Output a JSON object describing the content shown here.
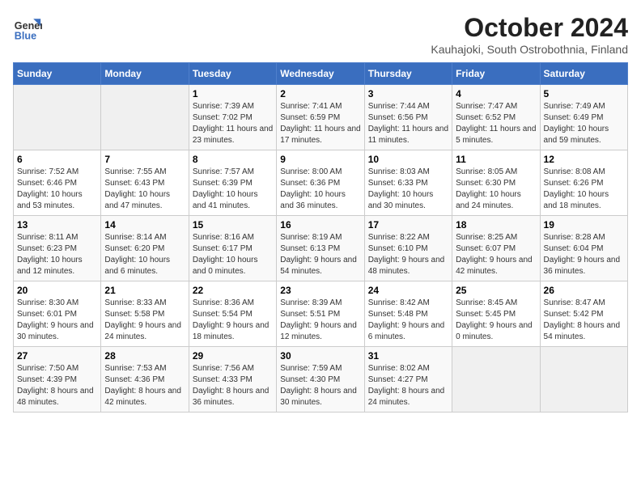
{
  "header": {
    "logo_line1": "General",
    "logo_line2": "Blue",
    "title": "October 2024",
    "subtitle": "Kauhajoki, South Ostrobothnia, Finland"
  },
  "weekdays": [
    "Sunday",
    "Monday",
    "Tuesday",
    "Wednesday",
    "Thursday",
    "Friday",
    "Saturday"
  ],
  "weeks": [
    [
      {
        "day": "",
        "info": ""
      },
      {
        "day": "",
        "info": ""
      },
      {
        "day": "1",
        "info": "Sunrise: 7:39 AM\nSunset: 7:02 PM\nDaylight: 11 hours and 23 minutes."
      },
      {
        "day": "2",
        "info": "Sunrise: 7:41 AM\nSunset: 6:59 PM\nDaylight: 11 hours and 17 minutes."
      },
      {
        "day": "3",
        "info": "Sunrise: 7:44 AM\nSunset: 6:56 PM\nDaylight: 11 hours and 11 minutes."
      },
      {
        "day": "4",
        "info": "Sunrise: 7:47 AM\nSunset: 6:52 PM\nDaylight: 11 hours and 5 minutes."
      },
      {
        "day": "5",
        "info": "Sunrise: 7:49 AM\nSunset: 6:49 PM\nDaylight: 10 hours and 59 minutes."
      }
    ],
    [
      {
        "day": "6",
        "info": "Sunrise: 7:52 AM\nSunset: 6:46 PM\nDaylight: 10 hours and 53 minutes."
      },
      {
        "day": "7",
        "info": "Sunrise: 7:55 AM\nSunset: 6:43 PM\nDaylight: 10 hours and 47 minutes."
      },
      {
        "day": "8",
        "info": "Sunrise: 7:57 AM\nSunset: 6:39 PM\nDaylight: 10 hours and 41 minutes."
      },
      {
        "day": "9",
        "info": "Sunrise: 8:00 AM\nSunset: 6:36 PM\nDaylight: 10 hours and 36 minutes."
      },
      {
        "day": "10",
        "info": "Sunrise: 8:03 AM\nSunset: 6:33 PM\nDaylight: 10 hours and 30 minutes."
      },
      {
        "day": "11",
        "info": "Sunrise: 8:05 AM\nSunset: 6:30 PM\nDaylight: 10 hours and 24 minutes."
      },
      {
        "day": "12",
        "info": "Sunrise: 8:08 AM\nSunset: 6:26 PM\nDaylight: 10 hours and 18 minutes."
      }
    ],
    [
      {
        "day": "13",
        "info": "Sunrise: 8:11 AM\nSunset: 6:23 PM\nDaylight: 10 hours and 12 minutes."
      },
      {
        "day": "14",
        "info": "Sunrise: 8:14 AM\nSunset: 6:20 PM\nDaylight: 10 hours and 6 minutes."
      },
      {
        "day": "15",
        "info": "Sunrise: 8:16 AM\nSunset: 6:17 PM\nDaylight: 10 hours and 0 minutes."
      },
      {
        "day": "16",
        "info": "Sunrise: 8:19 AM\nSunset: 6:13 PM\nDaylight: 9 hours and 54 minutes."
      },
      {
        "day": "17",
        "info": "Sunrise: 8:22 AM\nSunset: 6:10 PM\nDaylight: 9 hours and 48 minutes."
      },
      {
        "day": "18",
        "info": "Sunrise: 8:25 AM\nSunset: 6:07 PM\nDaylight: 9 hours and 42 minutes."
      },
      {
        "day": "19",
        "info": "Sunrise: 8:28 AM\nSunset: 6:04 PM\nDaylight: 9 hours and 36 minutes."
      }
    ],
    [
      {
        "day": "20",
        "info": "Sunrise: 8:30 AM\nSunset: 6:01 PM\nDaylight: 9 hours and 30 minutes."
      },
      {
        "day": "21",
        "info": "Sunrise: 8:33 AM\nSunset: 5:58 PM\nDaylight: 9 hours and 24 minutes."
      },
      {
        "day": "22",
        "info": "Sunrise: 8:36 AM\nSunset: 5:54 PM\nDaylight: 9 hours and 18 minutes."
      },
      {
        "day": "23",
        "info": "Sunrise: 8:39 AM\nSunset: 5:51 PM\nDaylight: 9 hours and 12 minutes."
      },
      {
        "day": "24",
        "info": "Sunrise: 8:42 AM\nSunset: 5:48 PM\nDaylight: 9 hours and 6 minutes."
      },
      {
        "day": "25",
        "info": "Sunrise: 8:45 AM\nSunset: 5:45 PM\nDaylight: 9 hours and 0 minutes."
      },
      {
        "day": "26",
        "info": "Sunrise: 8:47 AM\nSunset: 5:42 PM\nDaylight: 8 hours and 54 minutes."
      }
    ],
    [
      {
        "day": "27",
        "info": "Sunrise: 7:50 AM\nSunset: 4:39 PM\nDaylight: 8 hours and 48 minutes."
      },
      {
        "day": "28",
        "info": "Sunrise: 7:53 AM\nSunset: 4:36 PM\nDaylight: 8 hours and 42 minutes."
      },
      {
        "day": "29",
        "info": "Sunrise: 7:56 AM\nSunset: 4:33 PM\nDaylight: 8 hours and 36 minutes."
      },
      {
        "day": "30",
        "info": "Sunrise: 7:59 AM\nSunset: 4:30 PM\nDaylight: 8 hours and 30 minutes."
      },
      {
        "day": "31",
        "info": "Sunrise: 8:02 AM\nSunset: 4:27 PM\nDaylight: 8 hours and 24 minutes."
      },
      {
        "day": "",
        "info": ""
      },
      {
        "day": "",
        "info": ""
      }
    ]
  ]
}
